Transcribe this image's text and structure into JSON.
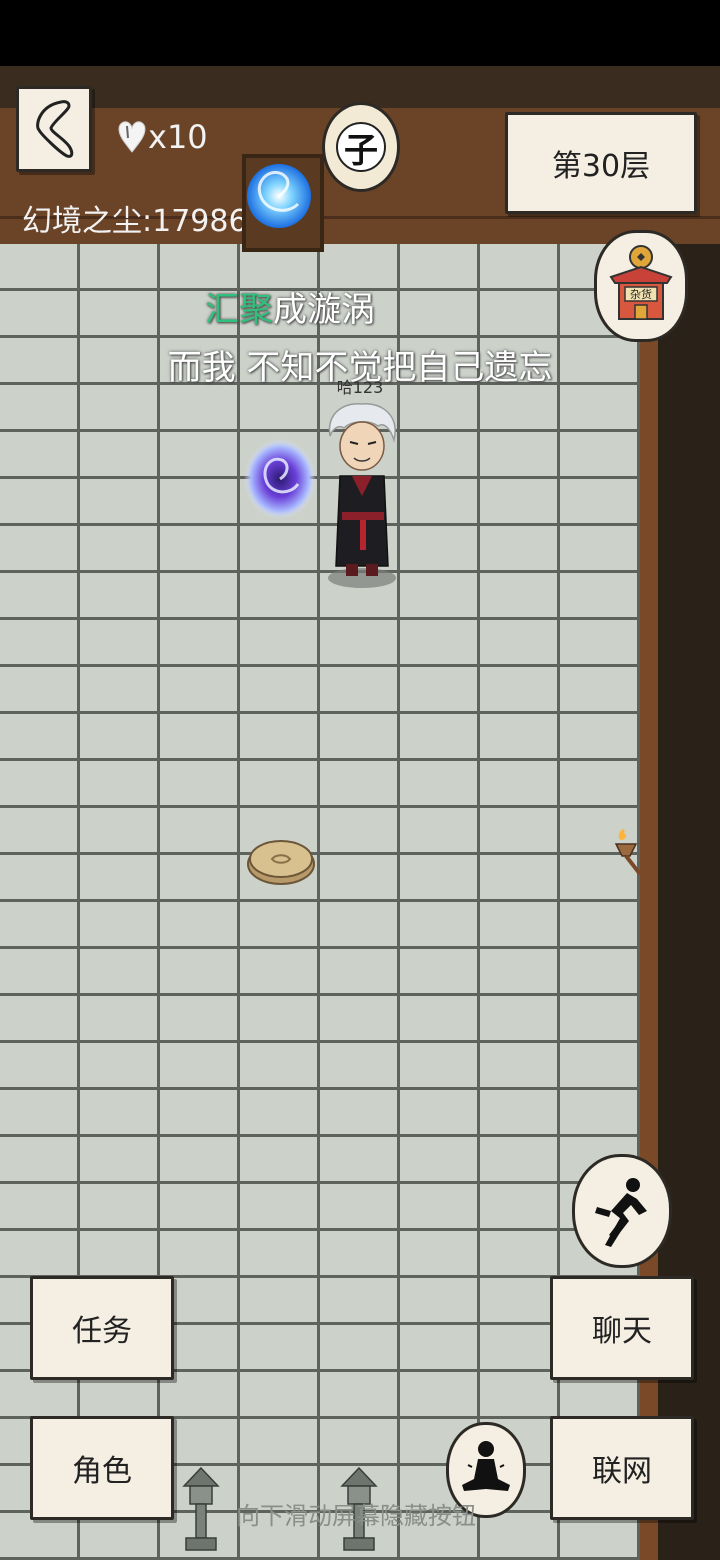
{
  "hud": {
    "lives_label": "x10",
    "dust_label": "幻境之尘:",
    "dust_value": "17986",
    "floor_label": "第30层",
    "time_glyph": "子"
  },
  "scene": {
    "lyric_line1_highlight": "汇聚",
    "lyric_line1_rest": "成漩涡",
    "lyric_line2": "而我 不知不觉把自己遗忘",
    "player_name": "哈123"
  },
  "buttons": {
    "task": "任务",
    "chat": "聊天",
    "role": "角色",
    "network": "联网"
  },
  "hint": "向下滑动屏幕隐藏按钮",
  "icons": {
    "back": "back-arrow-icon",
    "heart": "heart-icon",
    "vortex": "vortex-icon",
    "shop": "shop-icon",
    "run": "run-icon",
    "meditate": "meditate-icon"
  },
  "colors": {
    "lyric_highlight": "#2fc07b",
    "wall": "#6b4428",
    "floor": "#ccd2ca",
    "paper": "#f4efe2"
  }
}
